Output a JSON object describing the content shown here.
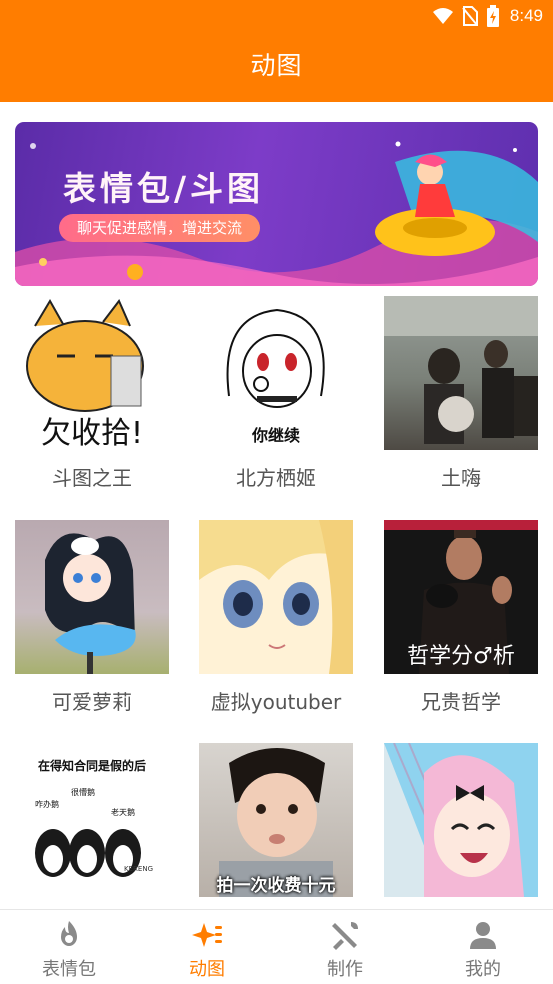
{
  "status_bar": {
    "time": "8:49"
  },
  "app_bar": {
    "title": "动图"
  },
  "banner": {
    "title": "表情包/斗图",
    "subtitle": "聊天促进感情，增进交流"
  },
  "grid": {
    "items": [
      {
        "label": "斗图之王",
        "thumb_text": "欠收拾!"
      },
      {
        "label": "北方栖姬",
        "thumb_text": "你继续"
      },
      {
        "label": "土嗨",
        "thumb_text": ""
      },
      {
        "label": "可爱萝莉",
        "thumb_text": ""
      },
      {
        "label": "虚拟youtuber",
        "thumb_text": ""
      },
      {
        "label": "兄贵哲学",
        "thumb_text": "哲学分♂析"
      },
      {
        "label": "",
        "thumb_text": "在得知合同是假的后",
        "extra": [
          "咋办鹅",
          "很懵鹅",
          "老天鹅",
          "KERENG"
        ]
      },
      {
        "label": "",
        "thumb_text": "拍一次收费十元"
      },
      {
        "label": "",
        "thumb_text": ""
      }
    ]
  },
  "tab_bar": {
    "tabs": [
      {
        "label": "表情包",
        "icon": "flame-icon"
      },
      {
        "label": "动图",
        "icon": "sparkle-list-icon"
      },
      {
        "label": "制作",
        "icon": "tools-icon"
      },
      {
        "label": "我的",
        "icon": "person-icon"
      }
    ],
    "active_index": 1,
    "active_color": "#ff7d00"
  },
  "colors": {
    "primary": "#ff7d00"
  }
}
